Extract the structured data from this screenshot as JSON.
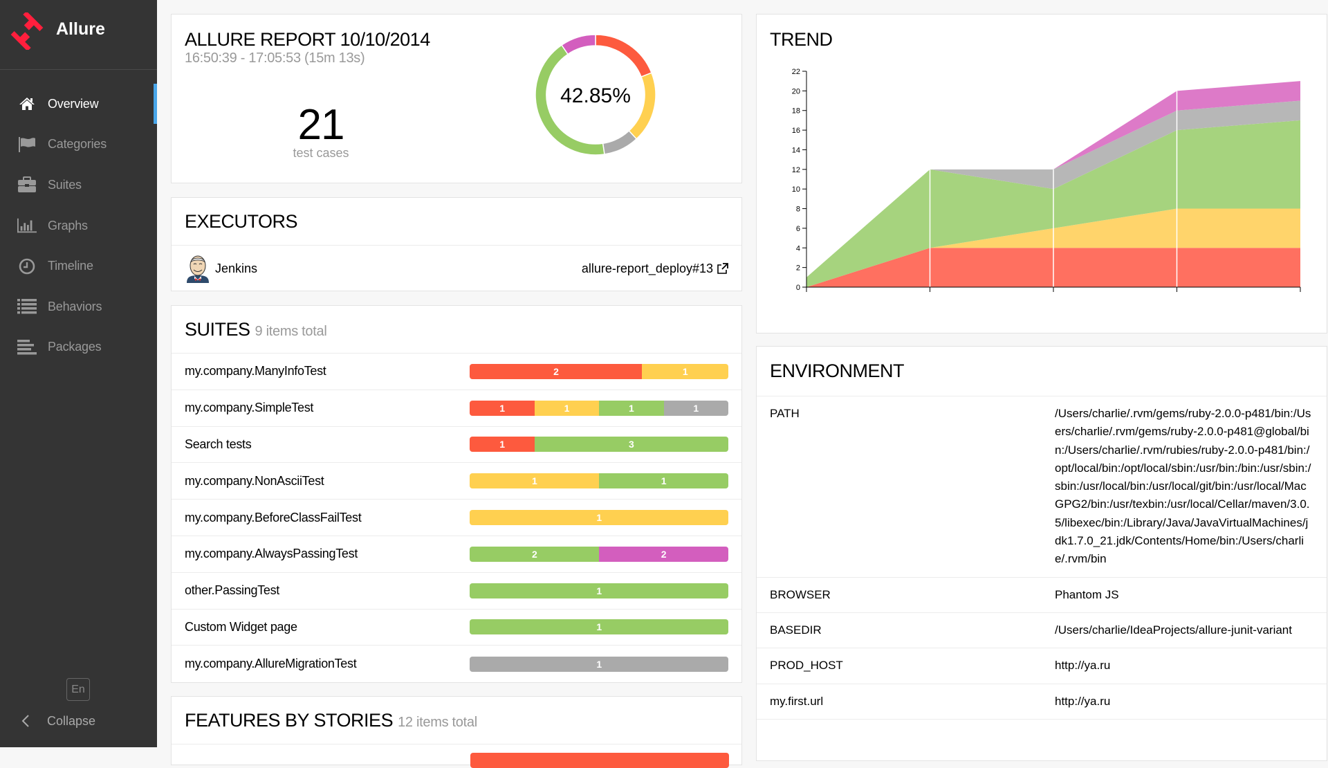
{
  "app": {
    "name": "Allure",
    "brand_color": "#ff1f3d"
  },
  "sidebar": {
    "items": [
      {
        "label": "Overview",
        "icon": "home-icon",
        "active": true
      },
      {
        "label": "Categories",
        "icon": "flag-icon",
        "active": false
      },
      {
        "label": "Suites",
        "icon": "briefcase-icon",
        "active": false
      },
      {
        "label": "Graphs",
        "icon": "bar-chart-icon",
        "active": false
      },
      {
        "label": "Timeline",
        "icon": "clock-icon",
        "active": false
      },
      {
        "label": "Behaviors",
        "icon": "list-icon",
        "active": false
      },
      {
        "label": "Packages",
        "icon": "align-left-icon",
        "active": false
      }
    ],
    "language": "En",
    "collapse_label": "Collapse"
  },
  "summary": {
    "title": "ALLURE REPORT 10/10/2014",
    "time_range": "16:50:39 - 17:05:53 (15m 13s)",
    "test_count": "21",
    "test_count_label": "test cases",
    "success_rate": "42.85%",
    "donut": [
      {
        "status": "failed",
        "value": 4,
        "color": "#fd5a3e"
      },
      {
        "status": "broken",
        "value": 4,
        "color": "#ffd050"
      },
      {
        "status": "skipped",
        "value": 2,
        "color": "#aaaaaa"
      },
      {
        "status": "passed",
        "value": 9,
        "color": "#97cc64"
      },
      {
        "status": "unknown",
        "value": 2,
        "color": "#d35ebe"
      }
    ]
  },
  "executors": {
    "title": "EXECUTORS",
    "items": [
      {
        "name": "Jenkins",
        "build": "allure-report_deploy#13"
      }
    ]
  },
  "suites": {
    "title": "SUITES",
    "subtitle": "9 items total",
    "items": [
      {
        "name": "my.company.ManyInfoTest",
        "segments": [
          {
            "status": "failed",
            "count": 2
          },
          {
            "status": "broken",
            "count": 1
          }
        ]
      },
      {
        "name": "my.company.SimpleTest",
        "segments": [
          {
            "status": "failed",
            "count": 1
          },
          {
            "status": "broken",
            "count": 1
          },
          {
            "status": "passed",
            "count": 1
          },
          {
            "status": "skipped",
            "count": 1
          }
        ]
      },
      {
        "name": "Search tests",
        "segments": [
          {
            "status": "failed",
            "count": 1
          },
          {
            "status": "passed",
            "count": 3
          }
        ]
      },
      {
        "name": "my.company.NonAsciiTest",
        "segments": [
          {
            "status": "broken",
            "count": 1
          },
          {
            "status": "passed",
            "count": 1
          }
        ]
      },
      {
        "name": "my.company.BeforeClassFailTest",
        "segments": [
          {
            "status": "broken",
            "count": 1
          }
        ]
      },
      {
        "name": "my.company.AlwaysPassingTest",
        "segments": [
          {
            "status": "passed",
            "count": 2
          },
          {
            "status": "unknown",
            "count": 2
          }
        ]
      },
      {
        "name": "other.PassingTest",
        "segments": [
          {
            "status": "passed",
            "count": 1
          }
        ]
      },
      {
        "name": "Custom Widget page",
        "segments": [
          {
            "status": "passed",
            "count": 1
          }
        ]
      },
      {
        "name": "my.company.AllureMigrationTest",
        "segments": [
          {
            "status": "skipped",
            "count": 1
          }
        ]
      }
    ]
  },
  "features": {
    "title": "FEATURES BY STORIES",
    "subtitle": "12 items total"
  },
  "status_colors": {
    "failed": "#fd5a3e",
    "broken": "#ffd050",
    "passed": "#97cc64",
    "skipped": "#aaaaaa",
    "unknown": "#d35ebe"
  },
  "trend": {
    "title": "TREND"
  },
  "chart_data": {
    "type": "area",
    "title": "TREND",
    "stacked": true,
    "x": [
      1,
      2,
      3,
      4,
      5
    ],
    "ylim": [
      0,
      22
    ],
    "yticks": [
      0,
      2,
      4,
      6,
      8,
      10,
      12,
      14,
      16,
      18,
      20,
      22
    ],
    "grid": false,
    "series": [
      {
        "name": "failed",
        "color": "#ff7060",
        "values": [
          0,
          4,
          4,
          4,
          4
        ]
      },
      {
        "name": "broken",
        "color": "#ffd46b",
        "values": [
          0,
          0,
          2,
          4,
          4
        ]
      },
      {
        "name": "passed",
        "color": "#a6d37e",
        "values": [
          1,
          8,
          4,
          8,
          9
        ]
      },
      {
        "name": "skipped",
        "color": "#b7b7b7",
        "values": [
          0,
          0,
          2,
          2,
          2
        ]
      },
      {
        "name": "unknown",
        "color": "#dd7ac8",
        "values": [
          0,
          0,
          0,
          2,
          2
        ]
      }
    ]
  },
  "environment": {
    "title": "ENVIRONMENT",
    "rows": [
      {
        "key": "PATH",
        "value": "/Users/charlie/.rvm/gems/ruby-2.0.0-p481/bin:/Users/charlie/.rvm/gems/ruby-2.0.0-p481@global/bin:/Users/charlie/.rvm/rubies/ruby-2.0.0-p481/bin:/opt/local/bin:/opt/local/sbin:/usr/bin:/bin:/usr/sbin:/sbin:/usr/local/bin:/usr/local/git/bin:/usr/local/MacGPG2/bin:/usr/texbin:/usr/local/Cellar/maven/3.0.5/libexec/bin:/Library/Java/JavaVirtualMachines/jdk1.7.0_21.jdk/Contents/Home/bin:/Users/charlie/.rvm/bin"
      },
      {
        "key": "BROWSER",
        "value": "Phantom JS"
      },
      {
        "key": "BASEDIR",
        "value": "/Users/charlie/IdeaProjects/allure-junit-variant"
      },
      {
        "key": "PROD_HOST",
        "value": "http://ya.ru"
      },
      {
        "key": "my.first.url",
        "value": "http://ya.ru"
      }
    ]
  }
}
